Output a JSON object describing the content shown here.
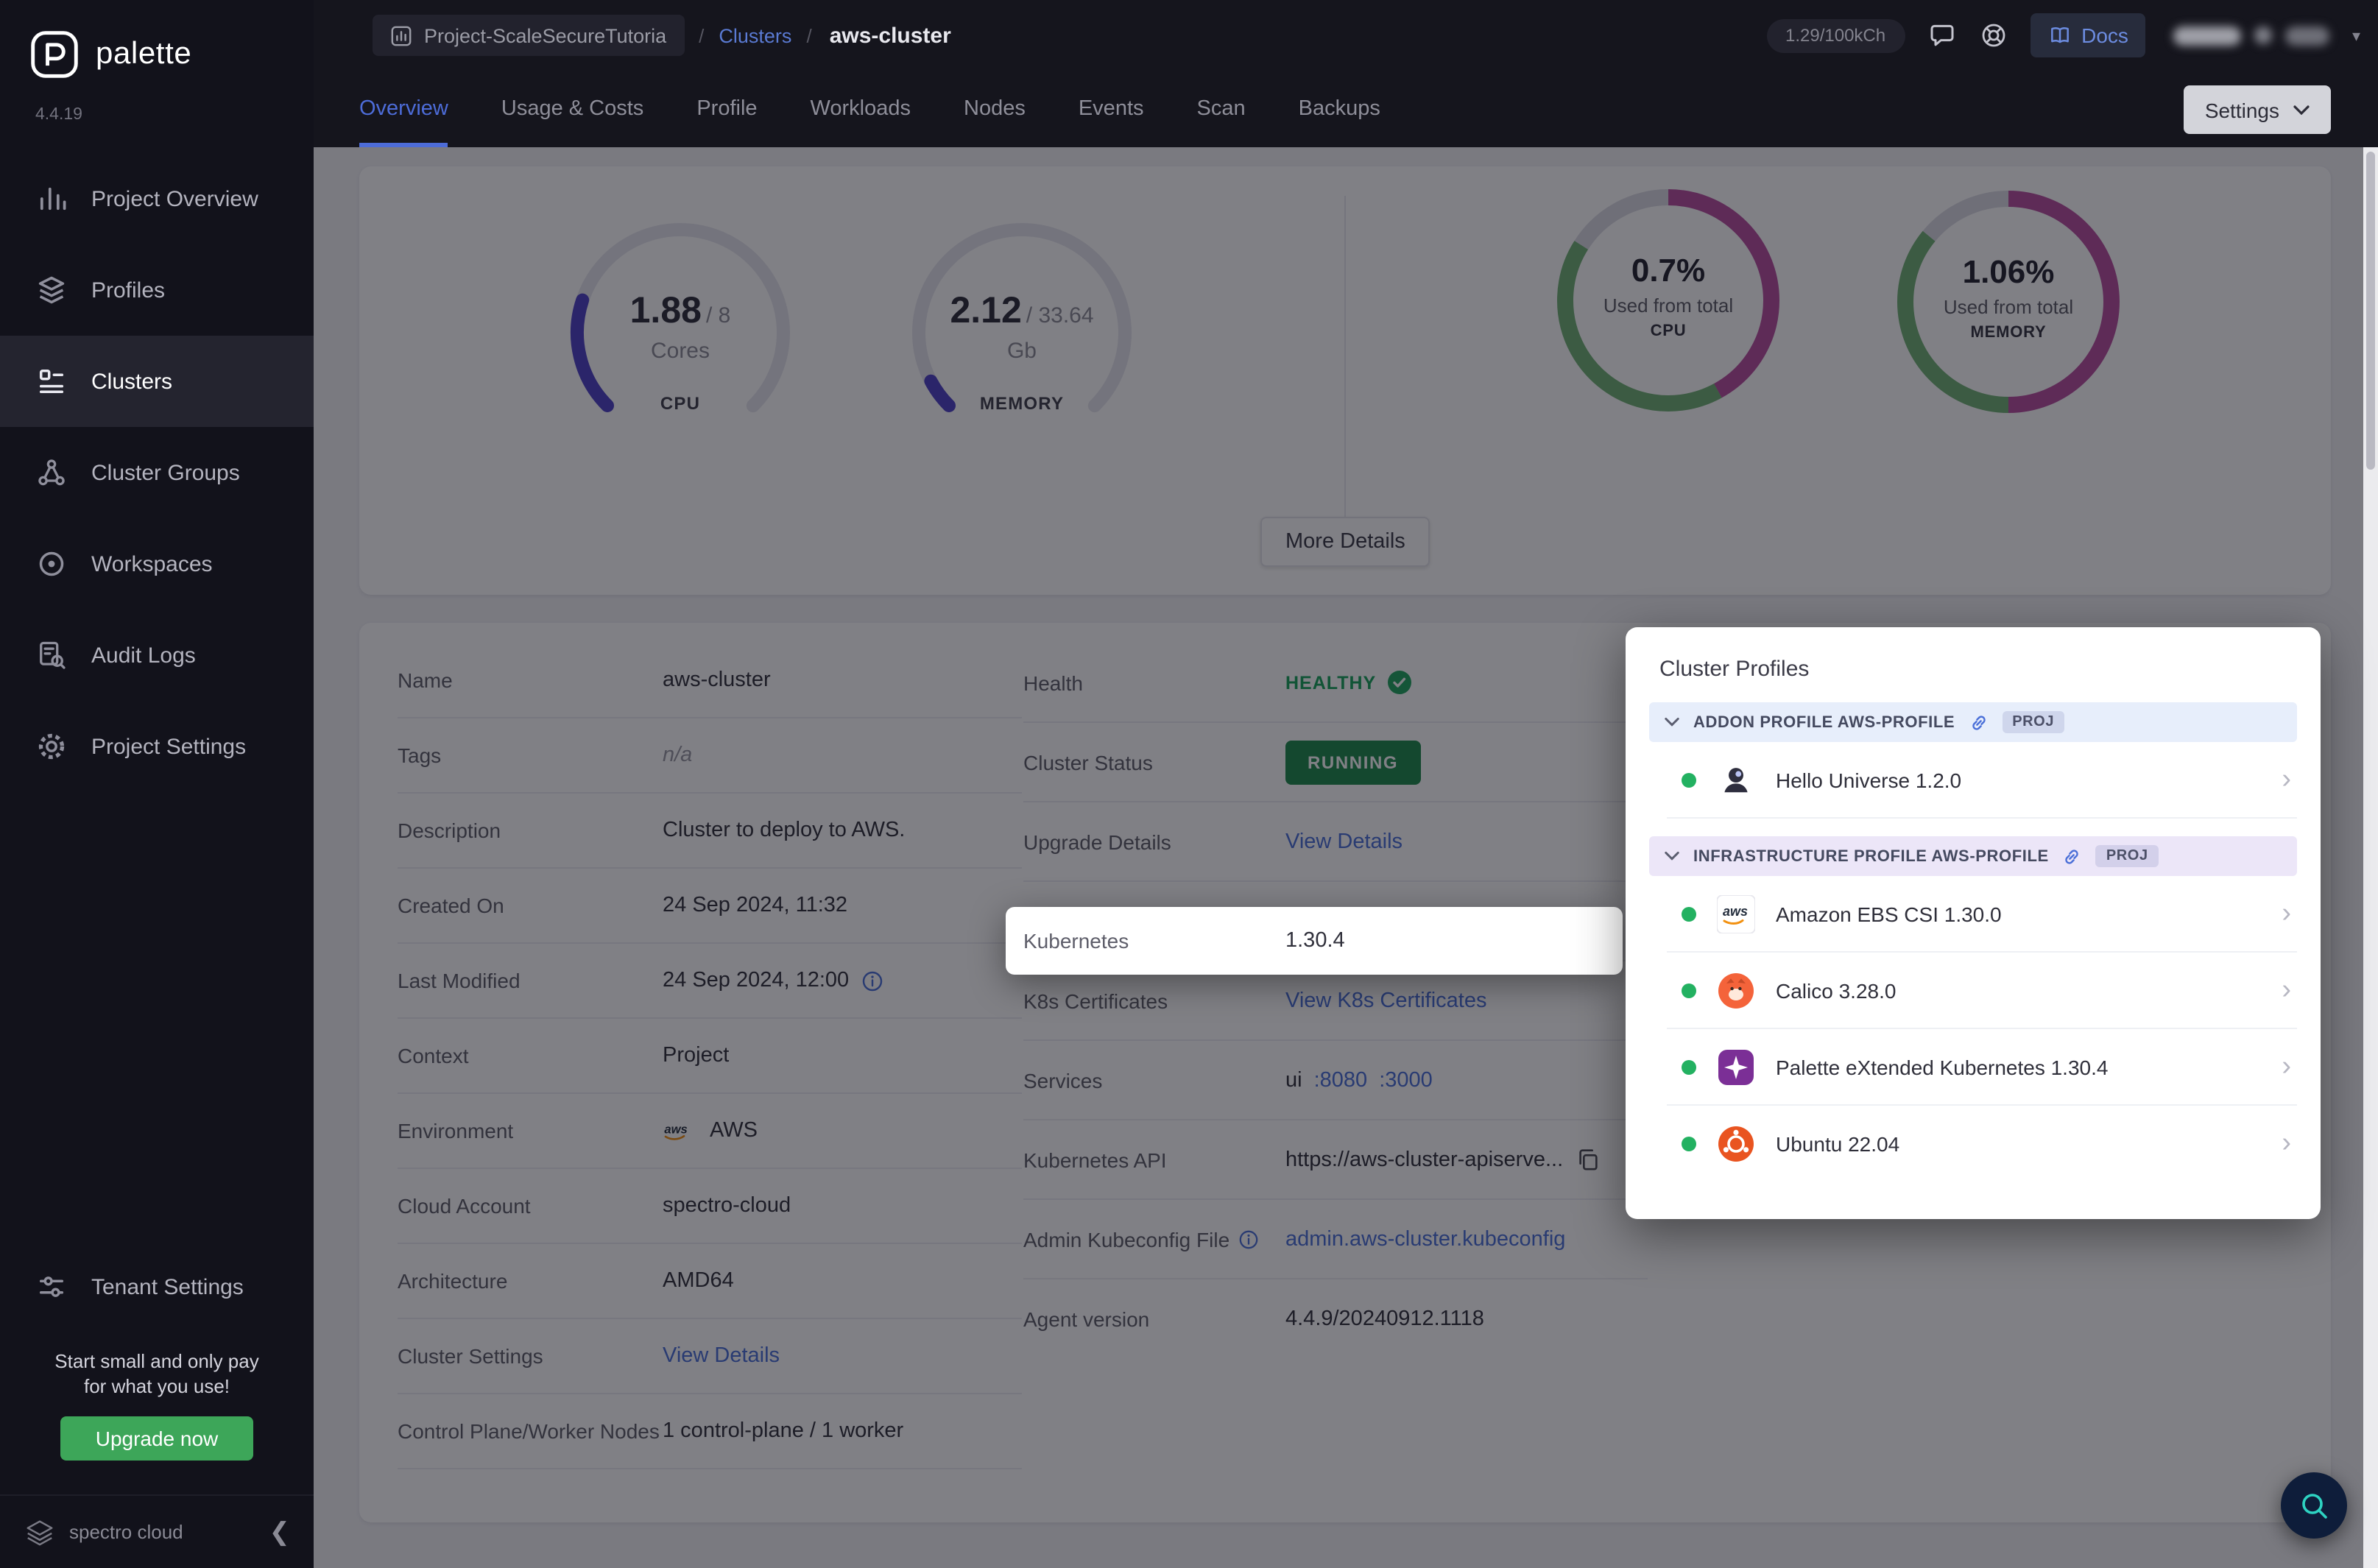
{
  "sidebar": {
    "logo_text": "palette",
    "version": "4.4.19",
    "items": [
      {
        "label": "Project Overview"
      },
      {
        "label": "Profiles"
      },
      {
        "label": "Clusters"
      },
      {
        "label": "Cluster Groups"
      },
      {
        "label": "Workspaces"
      },
      {
        "label": "Audit Logs"
      },
      {
        "label": "Project Settings"
      }
    ],
    "tenant_settings": "Tenant Settings",
    "promo": {
      "line1": "Start small and only pay",
      "line2": "for what you use!",
      "button_label": "Upgrade now"
    },
    "footer_brand": "spectro cloud"
  },
  "header": {
    "project_chip": "Project-ScaleSecureTutoria",
    "crumb_sep": "/",
    "clusters_link": "Clusters",
    "current": "aws-cluster",
    "usage_pill": "1.29/100kCh",
    "docs_label": "Docs"
  },
  "tabs": {
    "items": [
      "Overview",
      "Usage & Costs",
      "Profile",
      "Workloads",
      "Nodes",
      "Events",
      "Scan",
      "Backups"
    ],
    "settings_label": "Settings"
  },
  "chart_data": [
    {
      "type": "gauge",
      "label": "CPU",
      "value": 1.88,
      "max": 8,
      "value_display": "1.88",
      "max_display": "/ 8",
      "unit": "Cores",
      "color": "#4e41c7",
      "track_color": "#e7e7ee"
    },
    {
      "type": "gauge",
      "label": "MEMORY",
      "value": 2.12,
      "max": 33.64,
      "value_display": "2.12",
      "max_display": "/ 33.64",
      "unit": "Gb",
      "color": "#4e41c7",
      "track_color": "#e7e7ee"
    },
    {
      "type": "donut",
      "label": "CPU",
      "percent": 0.7,
      "percent_display": "0.7%",
      "caption": "Used from total",
      "segments": [
        {
          "color": "#b94fa0",
          "fraction": 0.42
        },
        {
          "color": "#72b275",
          "fraction": 0.42
        },
        {
          "color": "#dcdce4",
          "fraction": 0.16
        }
      ]
    },
    {
      "type": "donut",
      "label": "MEMORY",
      "percent": 1.06,
      "percent_display": "1.06%",
      "caption": "Used from total",
      "segments": [
        {
          "color": "#b94fa0",
          "fraction": 0.5
        },
        {
          "color": "#72b275",
          "fraction": 0.36
        },
        {
          "color": "#dcdce4",
          "fraction": 0.14
        }
      ]
    }
  ],
  "overview_card": {
    "more_details_label": "More Details"
  },
  "details": {
    "left": [
      {
        "label": "Name",
        "value": "aws-cluster"
      },
      {
        "label": "Tags",
        "value": "n/a"
      },
      {
        "label": "Description",
        "value": "Cluster to deploy to AWS."
      },
      {
        "label": "Created On",
        "value": "24 Sep 2024, 11:32"
      },
      {
        "label": "Last Modified",
        "value": "24 Sep 2024, 12:00"
      },
      {
        "label": "Context",
        "value": "Project"
      },
      {
        "label": "Environment",
        "value": "AWS"
      },
      {
        "label": "Cloud Account",
        "value": "spectro-cloud"
      },
      {
        "label": "Architecture",
        "value": "AMD64"
      },
      {
        "label": "Cluster Settings",
        "value": "View Details"
      },
      {
        "label": "Control Plane/Worker Nodes",
        "value": "1 control-plane / 1 worker"
      }
    ],
    "right": {
      "health_label": "Health",
      "health_value": "HEALTHY",
      "status_label": "Cluster Status",
      "status_value": "RUNNING",
      "upgrade_label": "Upgrade Details",
      "upgrade_value": "View Details",
      "kubernetes_label": "Kubernetes",
      "kubernetes_value": "1.30.4",
      "certs_label": "K8s Certificates",
      "certs_value": "View K8s Certificates",
      "services_label": "Services",
      "services_name": "ui",
      "services_ports": [
        ":8080",
        ":3000"
      ],
      "api_label": "Kubernetes API",
      "api_value": "https://aws-cluster-apiserve...",
      "kubeconfig_label": "Admin Kubeconfig File",
      "kubeconfig_value": "admin.aws-cluster.kubeconfig",
      "agent_label": "Agent version",
      "agent_value": "4.4.9/20240912.1118"
    }
  },
  "cluster_profiles": {
    "title": "Cluster Profiles",
    "groups": [
      {
        "header": "ADDON PROFILE AWS-PROFILE",
        "badge": "PROJ",
        "items": [
          {
            "name": "Hello Universe 1.2.0"
          }
        ]
      },
      {
        "header": "INFRASTRUCTURE PROFILE AWS-PROFILE",
        "badge": "PROJ",
        "items": [
          {
            "name": "Amazon EBS CSI 1.30.0"
          },
          {
            "name": "Calico 3.28.0"
          },
          {
            "name": "Palette eXtended Kubernetes 1.30.4"
          },
          {
            "name": "Ubuntu 22.04"
          }
        ]
      }
    ]
  }
}
